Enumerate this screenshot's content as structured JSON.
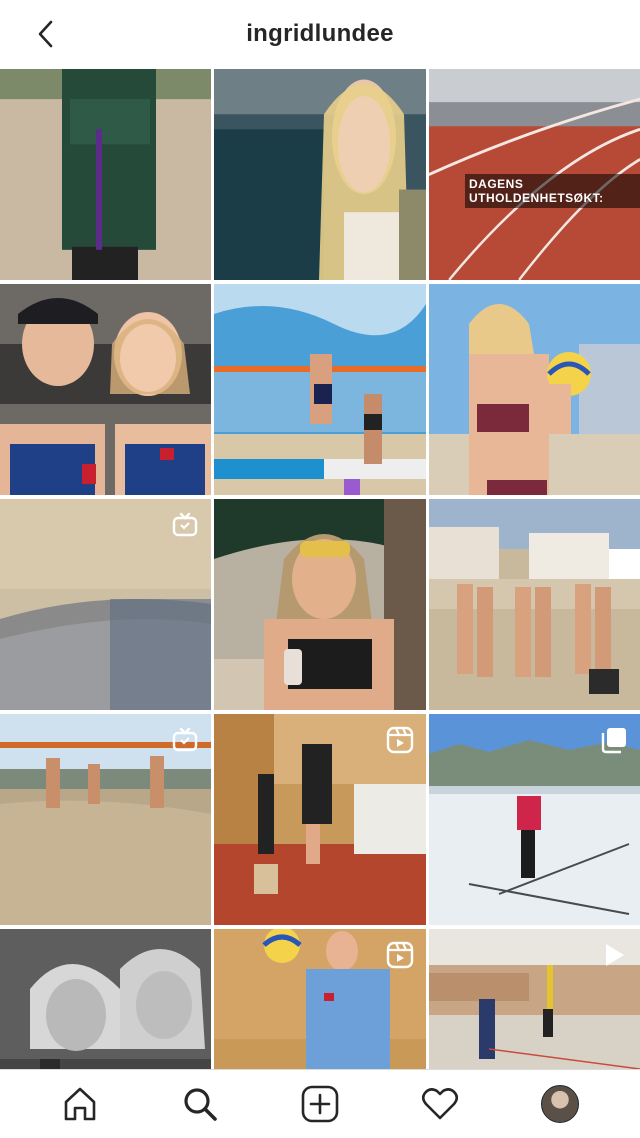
{
  "header": {
    "title": "ingridlundee",
    "back_icon": "chevron-left-icon"
  },
  "grid": {
    "posts": [
      {
        "id": "p1",
        "badge": ""
      },
      {
        "id": "p2",
        "badge": ""
      },
      {
        "id": "p3",
        "badge": "",
        "overlay_text": "DAGENS UTHOLDENHETSØKT:"
      },
      {
        "id": "p4",
        "badge": ""
      },
      {
        "id": "p5",
        "badge": ""
      },
      {
        "id": "p6",
        "badge": ""
      },
      {
        "id": "p7",
        "badge": "igtv-icon"
      },
      {
        "id": "p8",
        "badge": ""
      },
      {
        "id": "p9",
        "badge": ""
      },
      {
        "id": "p10",
        "badge": "igtv-icon"
      },
      {
        "id": "p11",
        "badge": "reels-icon"
      },
      {
        "id": "p12",
        "badge": "carousel-icon"
      },
      {
        "id": "p13",
        "badge": ""
      },
      {
        "id": "p14",
        "badge": "reels-icon"
      },
      {
        "id": "p15",
        "badge": "video-icon"
      }
    ]
  },
  "tabbar": {
    "items": [
      "home-icon",
      "search-icon",
      "new-post-icon",
      "activity-heart-icon",
      "profile-avatar"
    ]
  },
  "colors": {
    "text": "#262626",
    "divider": "#dbdbdb",
    "background": "#ffffff"
  }
}
